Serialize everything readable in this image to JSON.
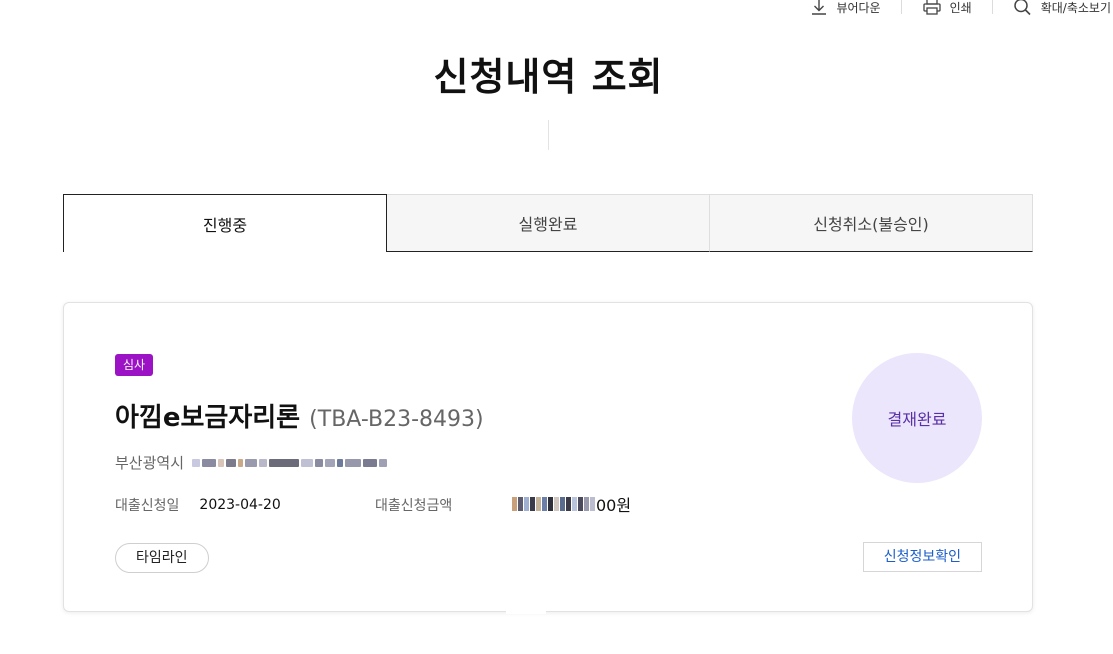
{
  "utility": {
    "viewer_download": "뷰어다운",
    "print": "인쇄",
    "zoom": "확대/축소보기"
  },
  "page_title": "신청내역 조회",
  "tabs": [
    {
      "label": "진행중",
      "active": true
    },
    {
      "label": "실행완료",
      "active": false
    },
    {
      "label": "신청취소(불승인)",
      "active": false
    }
  ],
  "card": {
    "status_badge": "심사",
    "product_name": "아낌e보금자리론",
    "product_code": "(TBA-B23-8493)",
    "address_city": "부산광역시",
    "loan_date_label": "대출신청일",
    "loan_date_value": "2023-04-20",
    "loan_amount_label": "대출신청금액",
    "loan_amount_suffix": "00원",
    "payment_status": "결재완료",
    "timeline_button": "타임라인",
    "detail_button": "신청정보확인"
  },
  "colors": {
    "badge": "#9b13c4",
    "payment_circle_bg": "#ebe6fb",
    "payment_text": "#5b2fa8",
    "link_blue": "#1c5fc9"
  }
}
